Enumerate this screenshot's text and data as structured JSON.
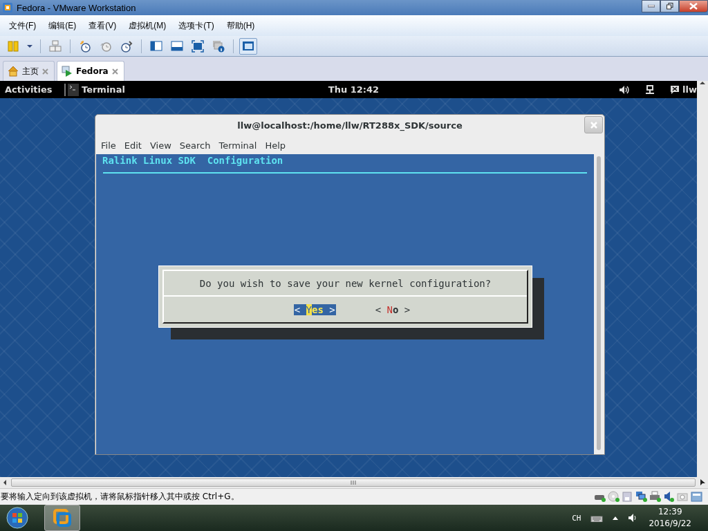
{
  "window": {
    "title": "Fedora - VMware Workstation"
  },
  "menu": [
    "文件(F)",
    "编辑(E)",
    "查看(V)",
    "虚拟机(M)",
    "选项卡(T)",
    "帮助(H)"
  ],
  "toolbar": [
    {
      "kind": "pause",
      "pressed": false
    },
    {
      "kind": "dropdown",
      "pressed": false
    },
    {
      "kind": "sep"
    },
    {
      "kind": "network",
      "pressed": false
    },
    {
      "kind": "sep"
    },
    {
      "kind": "snapshot",
      "pressed": false
    },
    {
      "kind": "revert",
      "pressed": false
    },
    {
      "kind": "manage",
      "pressed": false
    },
    {
      "kind": "sep"
    },
    {
      "kind": "sidebar",
      "pressed": false
    },
    {
      "kind": "bottombar",
      "pressed": false
    },
    {
      "kind": "fullscreen",
      "pressed": false
    },
    {
      "kind": "info",
      "pressed": false
    },
    {
      "kind": "sep"
    },
    {
      "kind": "console",
      "pressed": true
    }
  ],
  "tabs": [
    {
      "kind": "home",
      "label": "主页",
      "selected": false
    },
    {
      "kind": "vm",
      "label": "Fedora",
      "selected": true
    }
  ],
  "guest": {
    "top_bar": {
      "activities": "Activities",
      "app": "Terminal",
      "clock": "Thu 12:42",
      "user": "llw"
    },
    "terminal": {
      "title": "llw@localhost:/home/llw/RT288x_SDK/source",
      "menu": [
        "File",
        "Edit",
        "View",
        "Search",
        "Terminal",
        "Help"
      ],
      "header": "Ralink Linux SDK  Configuration",
      "dialog": {
        "question": "Do you wish to save your new kernel configuration?",
        "buttons": [
          {
            "open": "<",
            "hotkey": "Y",
            "rest": "es",
            "close": ">",
            "selected": true
          },
          {
            "open": "<",
            "hotkey": "N",
            "rest": "o",
            "close": ">",
            "selected": false
          }
        ]
      }
    }
  },
  "status_bar": {
    "message": "要将输入定向到该虚拟机，请将鼠标指针移入其中或按 Ctrl+G。"
  },
  "taskbar": {
    "language": "CH",
    "time": "12:39",
    "date": "2016/9/22"
  }
}
